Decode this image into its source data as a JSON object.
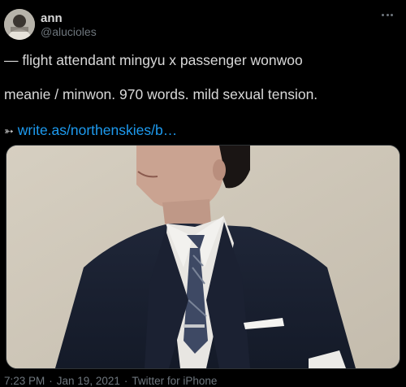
{
  "author": {
    "name": "ann",
    "handle": "@alucioles",
    "avatar_icon": "profile-photo"
  },
  "more_icon": "more-horizontal-icon",
  "tweet": {
    "line1": "— flight attendant mingyu x passenger wonwoo",
    "line2": "meanie / minwon. 970 words. mild sexual tension.",
    "arrow_symbol": "➳",
    "link_text": "write.as/northenskies/b…"
  },
  "media": {
    "description_icon": "photo-man-in-suit"
  },
  "meta": {
    "time": "7:23 PM",
    "separator": "·",
    "date": "Jan 19, 2021",
    "source": "Twitter for iPhone"
  },
  "colors": {
    "background": "#000000",
    "text": "#d9d9d9",
    "secondary": "#6e767d",
    "link": "#1d9bf0"
  }
}
